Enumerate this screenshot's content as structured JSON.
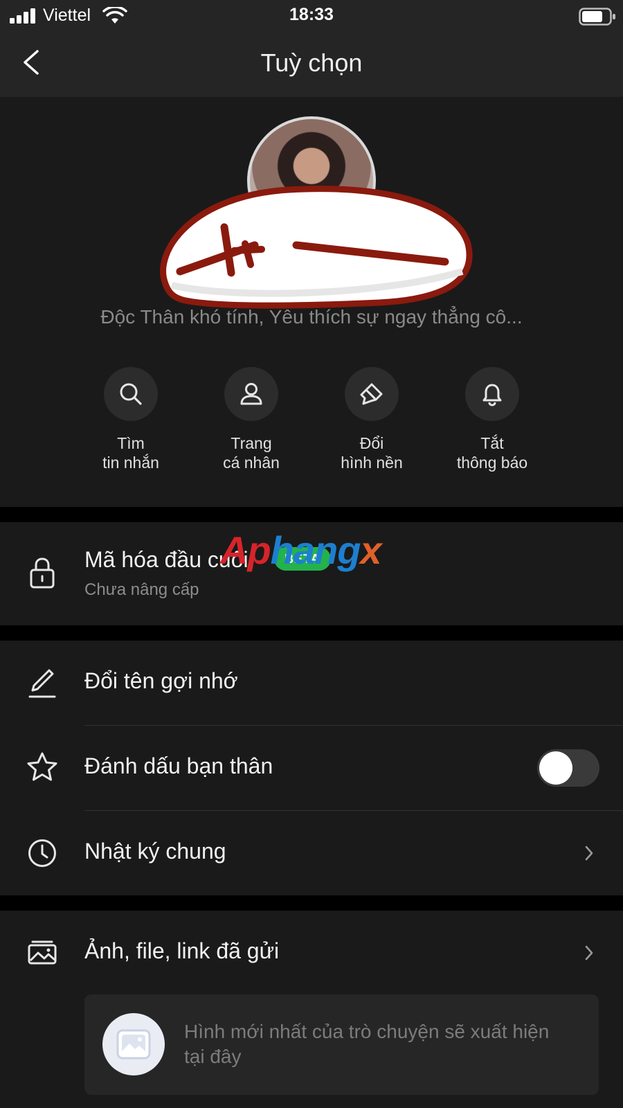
{
  "status_bar": {
    "carrier": "Viettel",
    "time": "18:33"
  },
  "header": {
    "title": "Tuỳ chọn"
  },
  "profile": {
    "status_message": "Độc Thân khó tính, Yêu thích sự ngay thẳng cô..."
  },
  "quick_actions": [
    {
      "line1": "Tìm",
      "line2": "tin nhắn",
      "icon": "search-icon"
    },
    {
      "line1": "Trang",
      "line2": "cá nhân",
      "icon": "person-icon"
    },
    {
      "line1": "Đổi",
      "line2": "hình nền",
      "icon": "paint-brush-icon"
    },
    {
      "line1": "Tắt",
      "line2": "thông báo",
      "icon": "bell-icon"
    }
  ],
  "encryption": {
    "title": "Mã hóa đầu cuối",
    "badge": "BETA",
    "subtitle": "Chưa nâng cấp"
  },
  "watermark": {
    "part1": "Ap",
    "part2": "hang",
    "part3": "x"
  },
  "settings": {
    "rename": "Đổi tên gợi nhớ",
    "best_friend": "Đánh dấu bạn thân",
    "best_friend_enabled": false,
    "journal": "Nhật ký chung"
  },
  "media": {
    "label": "Ảnh, file, link đã gửi",
    "hint": "Hình mới nhất của trò chuyện sẽ xuất hiện tại đây"
  },
  "colors": {
    "background": "#1a1a1a",
    "header": "#252525",
    "beta_badge": "#23b24c",
    "sticker_outline": "#8a1a0e"
  }
}
